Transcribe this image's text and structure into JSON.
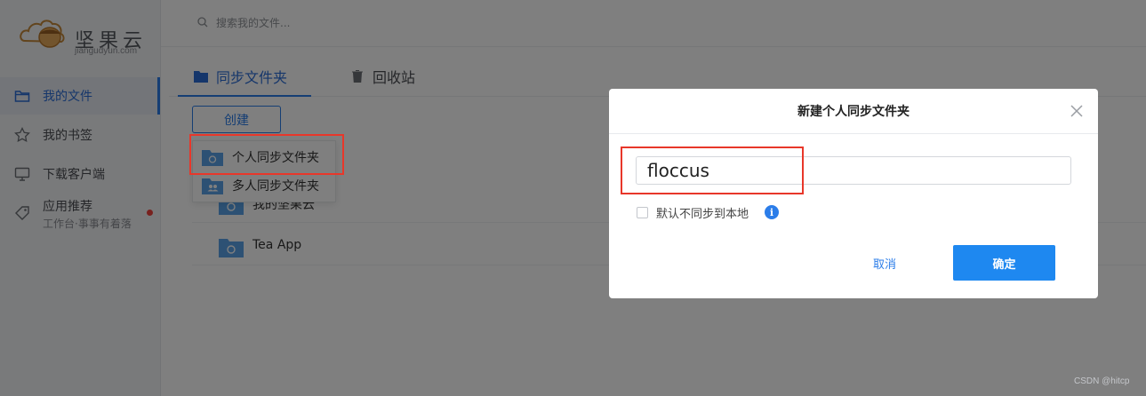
{
  "brand": {
    "name": "坚果云",
    "domain": "jiangudyun.com"
  },
  "sidebar": {
    "items": [
      {
        "label": "我的文件",
        "icon": "folder-outline-icon"
      },
      {
        "label": "我的书签",
        "icon": "star-outline-icon"
      },
      {
        "label": "下载客户端",
        "icon": "monitor-icon"
      },
      {
        "label": "应用推荐",
        "sub": "工作台·事事有着落",
        "icon": "tag-icon",
        "badge_color": "#f0433d"
      }
    ]
  },
  "search": {
    "placeholder": "搜索我的文件..."
  },
  "tabs": [
    {
      "label": "同步文件夹",
      "icon": "folder-solid-icon"
    },
    {
      "label": "回收站",
      "icon": "trash-icon"
    }
  ],
  "create_button": "创建",
  "dropdown": {
    "items": [
      "个人同步文件夹",
      "多人同步文件夹"
    ]
  },
  "folders": [
    {
      "name": "我的坚果云"
    },
    {
      "name": "Tea App"
    }
  ],
  "dialog": {
    "title": "新建个人同步文件夹",
    "input_value": "floccus",
    "checkbox_label": "默认不同步到本地",
    "cancel_label": "取消",
    "ok_label": "确定"
  },
  "watermark": "CSDN @hitcp",
  "colors": {
    "accent": "#2b7de9",
    "primary_button": "#1e88f0",
    "highlight_box": "#e8372a"
  }
}
